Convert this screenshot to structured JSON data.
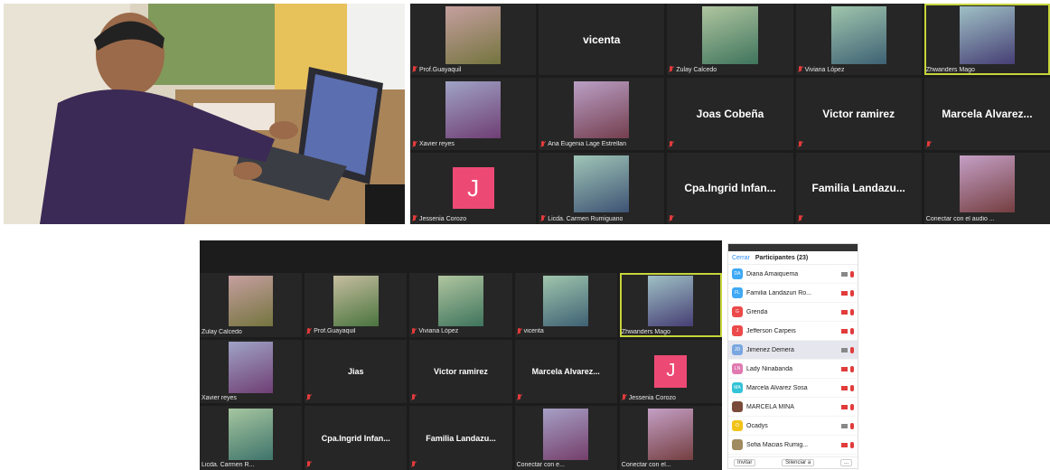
{
  "colors": {
    "active_speaker": "#c6d63a",
    "avatar_j": "#ec4a74",
    "accent": "#2d8cff",
    "muted": "#e23b3b"
  },
  "zoom_top": {
    "tiles": [
      {
        "label": "Prof.Guayaquil",
        "kind": "video",
        "muted": true
      },
      {
        "center_name": "vicenta",
        "kind": "name"
      },
      {
        "label": "Zulay Calcedo",
        "kind": "video",
        "muted": true
      },
      {
        "label": "Viviana López",
        "kind": "video",
        "muted": true
      },
      {
        "label": "Zhwanders Mago",
        "kind": "video",
        "active": true
      },
      {
        "label": "Xavier reyes",
        "kind": "video",
        "muted": true
      },
      {
        "label": "Ana Eugenia Lage Estrellan",
        "kind": "video",
        "muted": true
      },
      {
        "center_name": "Joas Cobeña",
        "kind": "name",
        "muted": true
      },
      {
        "center_name": "Victor ramirez",
        "kind": "name",
        "muted": true
      },
      {
        "center_name": "Marcela Alvarez...",
        "kind": "name",
        "muted": true
      },
      {
        "label": "Jessenia Corozo",
        "kind": "avatar",
        "avatar": "J",
        "muted": true
      },
      {
        "label": "Licda. Carmen Rumiguano",
        "kind": "video",
        "muted": true
      },
      {
        "center_name": "Cpa.Ingrid Infan...",
        "kind": "name",
        "muted": true
      },
      {
        "center_name": "Familia Landazu...",
        "kind": "name",
        "muted": true
      },
      {
        "label": "Conectar con el audio ...",
        "kind": "video"
      }
    ]
  },
  "zoom_bottom": {
    "tiles": [
      {
        "label": "Zulay Calcedo",
        "kind": "video"
      },
      {
        "label": "Prof.Guayaquil",
        "kind": "video",
        "muted": true
      },
      {
        "label": "Viviana López",
        "kind": "video",
        "muted": true
      },
      {
        "label": "vicenta",
        "kind": "video",
        "muted": true
      },
      {
        "label": "Zhwanders Mago",
        "kind": "video",
        "active": true
      },
      {
        "label": "Xavier reyes",
        "kind": "video"
      },
      {
        "center_name": "Jias",
        "kind": "name",
        "muted": true
      },
      {
        "center_name": "Victor ramirez",
        "kind": "name",
        "muted": true
      },
      {
        "center_name": "Marcela Alvarez...",
        "kind": "name",
        "muted": true
      },
      {
        "label": "Jessenia Corozo",
        "kind": "avatar",
        "avatar": "J",
        "muted": true
      },
      {
        "label": "Licda. Carmen R...",
        "kind": "video"
      },
      {
        "center_name": "Cpa.Ingrid Infan...",
        "kind": "name",
        "muted": true
      },
      {
        "center_name": "Familia Landazu...",
        "kind": "name",
        "muted": true
      },
      {
        "label": "Conectar con e...",
        "kind": "video"
      },
      {
        "label": "Conectar con el...",
        "kind": "video"
      }
    ]
  },
  "participants_panel": {
    "close_label": "Cerrar",
    "title": "Participantes (23)",
    "items": [
      {
        "initials": "DA",
        "name": "Diana Amaiquema",
        "color": "#3fa9f5",
        "cam_off": false,
        "mic_on": false
      },
      {
        "initials": "FL",
        "name": "Familia Landazuri Ro...",
        "color": "#3fa9f5",
        "cam_off": true,
        "mic_on": false
      },
      {
        "initials": "G",
        "name": "Grenda",
        "color": "#ec4a4a",
        "cam_off": true,
        "mic_on": false
      },
      {
        "initials": "J",
        "name": "Jefferson Carpeis",
        "color": "#ec4a4a",
        "cam_off": true,
        "mic_on": false
      },
      {
        "initials": "JD",
        "name": "Jimenez Demera",
        "color": "#7aa7e0",
        "cam_off": false,
        "mic_on": false,
        "selected": true
      },
      {
        "initials": "LN",
        "name": "Lady Ninabanda",
        "color": "#e07ab0",
        "cam_off": true,
        "mic_on": false
      },
      {
        "initials": "MA",
        "name": "Marcela Alvarez Sosa",
        "color": "#33c3d6",
        "cam_off": true,
        "mic_on": false
      },
      {
        "initials": "",
        "name": "MARCELA MINA",
        "color": "#7a4a3a",
        "cam_off": true,
        "mic_on": false
      },
      {
        "initials": "O",
        "name": "Ocadys",
        "color": "#f2c31b",
        "cam_off": false,
        "mic_on": false
      },
      {
        "initials": "",
        "name": "Sofia Macias Rumig...",
        "color": "#a08a60",
        "cam_off": true,
        "mic_on": false
      }
    ],
    "invite_label": "Invitar",
    "mute_all_label": "Silenciar a",
    "more_label": "..."
  }
}
